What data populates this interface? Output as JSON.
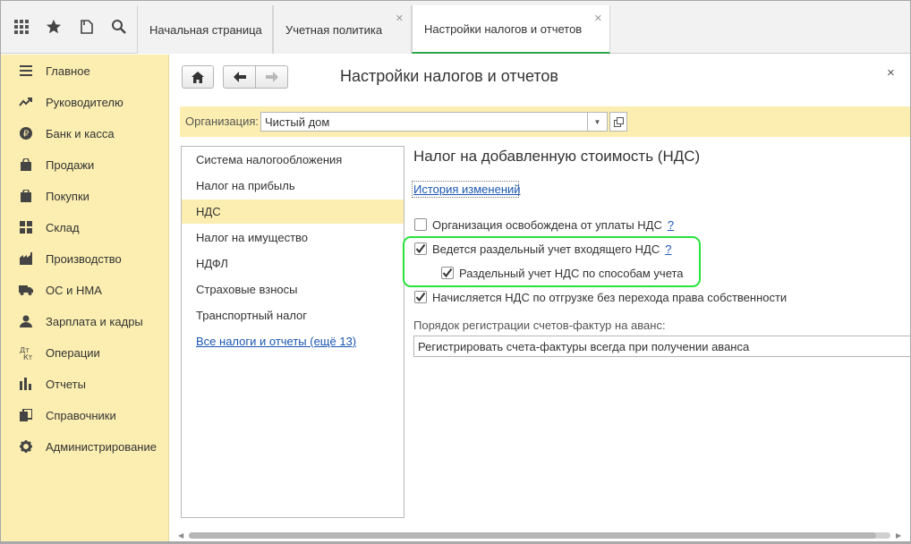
{
  "topbar": {
    "icons": [
      "apps-grid-icon",
      "star-icon",
      "history-icon",
      "search-icon"
    ],
    "tabs": [
      {
        "label": "Начальная страница",
        "active": false,
        "closable": false
      },
      {
        "label": "Учетная политика",
        "active": false,
        "closable": true
      },
      {
        "label": "Настройки налогов и отчетов",
        "active": true,
        "closable": true
      }
    ]
  },
  "sidebar": {
    "items": [
      {
        "label": "Главное",
        "icon": "menu-lines-icon"
      },
      {
        "label": "Руководителю",
        "icon": "trend-chart-icon"
      },
      {
        "label": "Банк и касса",
        "icon": "ruble-coin-icon"
      },
      {
        "label": "Продажи",
        "icon": "shopping-bag-icon"
      },
      {
        "label": "Покупки",
        "icon": "cart-icon"
      },
      {
        "label": "Склад",
        "icon": "warehouse-icon"
      },
      {
        "label": "Производство",
        "icon": "factory-icon"
      },
      {
        "label": "ОС и НМА",
        "icon": "truck-icon"
      },
      {
        "label": "Зарплата и кадры",
        "icon": "people-icon"
      },
      {
        "label": "Операции",
        "icon": "debit-credit-icon"
      },
      {
        "label": "Отчеты",
        "icon": "bar-chart-icon"
      },
      {
        "label": "Справочники",
        "icon": "books-icon"
      },
      {
        "label": "Администрирование",
        "icon": "gear-icon"
      }
    ]
  },
  "header": {
    "title": "Настройки налогов и отчетов",
    "close": "×"
  },
  "org": {
    "label": "Организация:",
    "value": "Чистый дом"
  },
  "left_panel": {
    "items": [
      {
        "label": "Система налогообложения",
        "selected": false,
        "link": false
      },
      {
        "label": "Налог на прибыль",
        "selected": false,
        "link": false
      },
      {
        "label": "НДС",
        "selected": true,
        "link": false
      },
      {
        "label": "Налог на имущество",
        "selected": false,
        "link": false
      },
      {
        "label": "НДФЛ",
        "selected": false,
        "link": false
      },
      {
        "label": "Страховые взносы",
        "selected": false,
        "link": false
      },
      {
        "label": "Транспортный налог",
        "selected": false,
        "link": false
      },
      {
        "label": "Все налоги и отчеты (ещё 13)",
        "selected": false,
        "link": true
      }
    ]
  },
  "vat": {
    "section_title": "Налог на добавленную стоимость (НДС)",
    "history_link": "История изменений",
    "options": [
      {
        "label": "Организация освобождена от уплаты НДС",
        "checked": false,
        "help": "?"
      },
      {
        "label": "Ведется раздельный учет входящего НДС",
        "checked": true,
        "help": "?"
      },
      {
        "label": "Раздельный учет НДС по способам учета",
        "checked": true,
        "help": ""
      },
      {
        "label": "Начисляется НДС по отгрузке без перехода права собственности",
        "checked": true,
        "help": ""
      }
    ],
    "advance_label": "Порядок регистрации счетов-фактур на аванс:",
    "advance_value": "Регистрировать счета-фактуры всегда при получении аванса"
  },
  "colors": {
    "sidebar_bg": "#fbeeb0",
    "active_tab_underline": "#2ba84a",
    "highlight_box": "#27e33a",
    "link": "#1a56b0"
  }
}
